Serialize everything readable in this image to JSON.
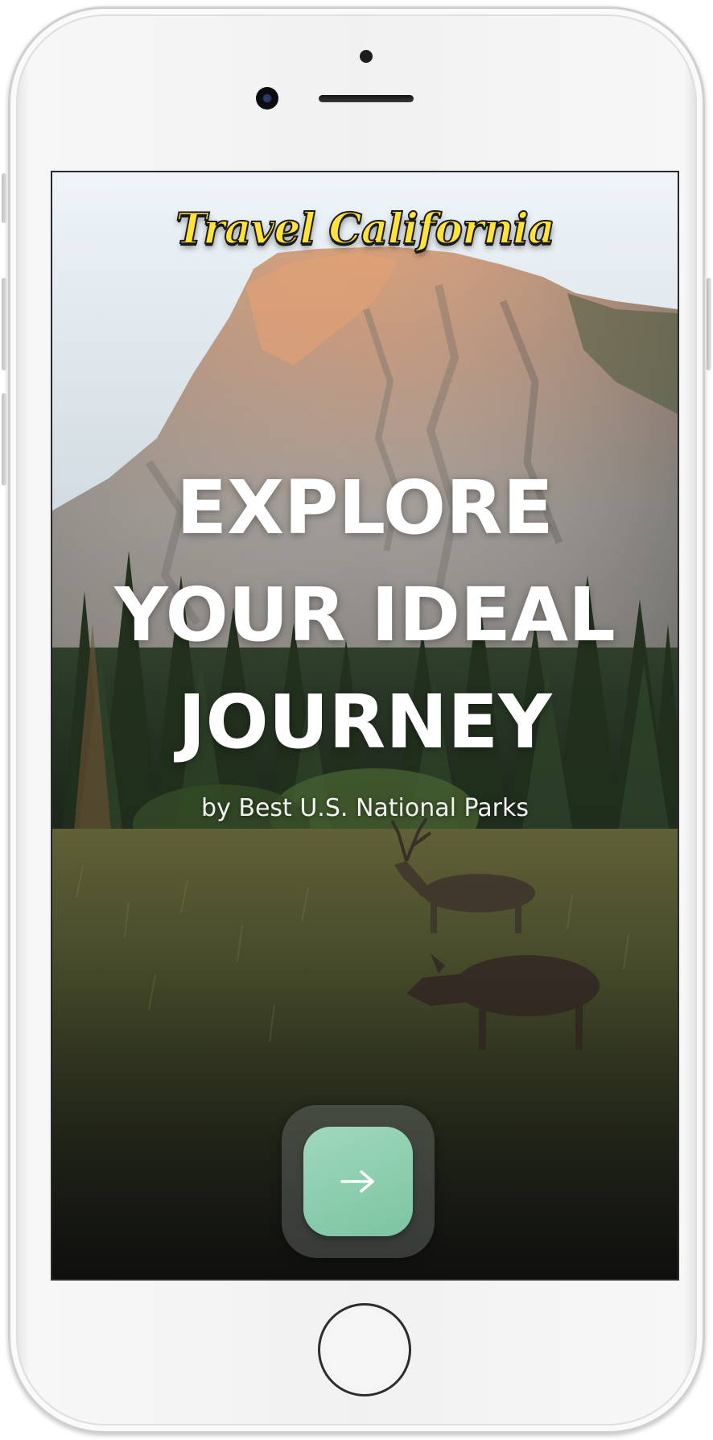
{
  "app": {
    "brand_title": "Travel California"
  },
  "hero": {
    "headline_lines": [
      "EXPLORE",
      "YOUR IDEAL",
      "JOURNEY"
    ],
    "subtitle": "by Best U.S. National Parks"
  },
  "actions": {
    "next_icon": "arrow-right-icon"
  },
  "colors": {
    "brand_title": "#ffe33a",
    "button_accent": "#8ccfb0",
    "headline": "#ffffff"
  }
}
